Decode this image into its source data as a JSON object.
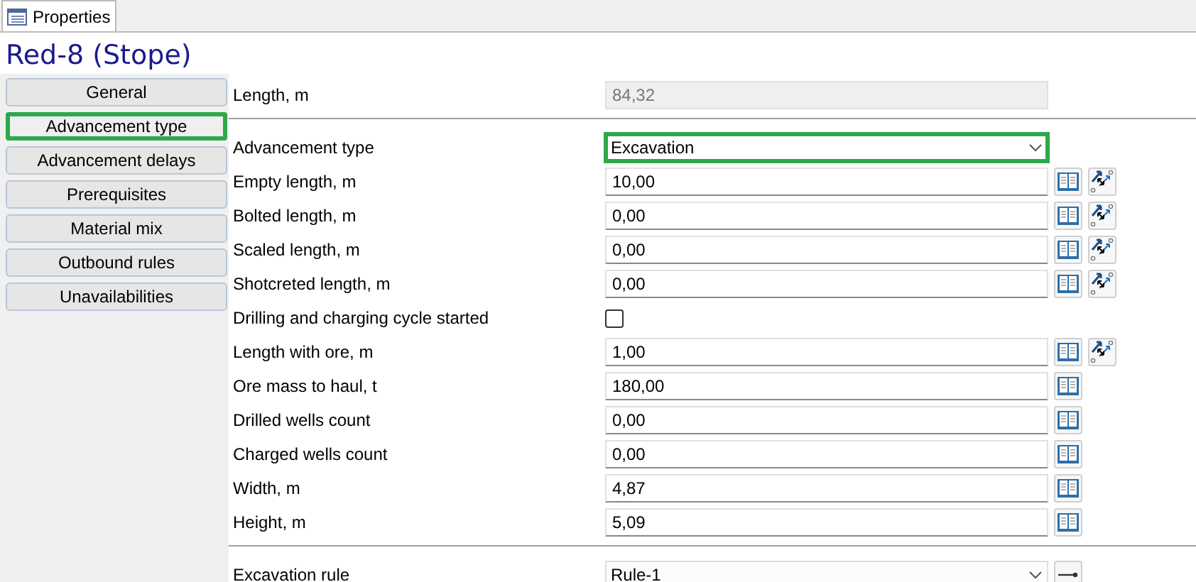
{
  "tab": {
    "label": "Properties"
  },
  "title": "Red-8 (Stope)",
  "nav": [
    {
      "label": "General",
      "selected": false
    },
    {
      "label": "Advancement type",
      "selected": true
    },
    {
      "label": "Advancement delays",
      "selected": false
    },
    {
      "label": "Prerequisites",
      "selected": false
    },
    {
      "label": "Material mix",
      "selected": false
    },
    {
      "label": "Outbound rules",
      "selected": false
    },
    {
      "label": "Unavailabilities",
      "selected": false
    }
  ],
  "rows": [
    {
      "kind": "readonly",
      "label": "Length, m",
      "value": "84,32"
    },
    {
      "kind": "select",
      "label": "Advancement type",
      "value": "Excavation",
      "highlighted": true,
      "separator_before": true
    },
    {
      "kind": "number",
      "label": "Empty length, m",
      "value": "10,00",
      "book": true,
      "pick": true
    },
    {
      "kind": "number",
      "label": "Bolted length, m",
      "value": "0,00",
      "book": true,
      "pick": true
    },
    {
      "kind": "number",
      "label": "Scaled length, m",
      "value": "0,00",
      "book": true,
      "pick": true
    },
    {
      "kind": "number",
      "label": "Shotcreted length, m",
      "value": "0,00",
      "book": true,
      "pick": true
    },
    {
      "kind": "checkbox",
      "label": "Drilling and charging cycle started",
      "checked": false
    },
    {
      "kind": "number",
      "label": "Length with ore, m",
      "value": "1,00",
      "book": true,
      "pick": true
    },
    {
      "kind": "number",
      "label": "Ore mass to haul, t",
      "value": "180,00",
      "book": true,
      "pick": false
    },
    {
      "kind": "number",
      "label": "Drilled wells count",
      "value": "0,00",
      "book": true,
      "pick": false
    },
    {
      "kind": "number",
      "label": "Charged wells count",
      "value": "0,00",
      "book": true,
      "pick": false
    },
    {
      "kind": "number",
      "label": "Width, m",
      "value": "4,87",
      "book": true,
      "pick": false
    },
    {
      "kind": "number",
      "label": "Height, m",
      "value": "5,09",
      "book": true,
      "pick": false
    },
    {
      "kind": "select",
      "label": "Excavation rule",
      "value": "Rule-1",
      "highlighted": false,
      "separator_before": true,
      "go": true
    }
  ]
}
